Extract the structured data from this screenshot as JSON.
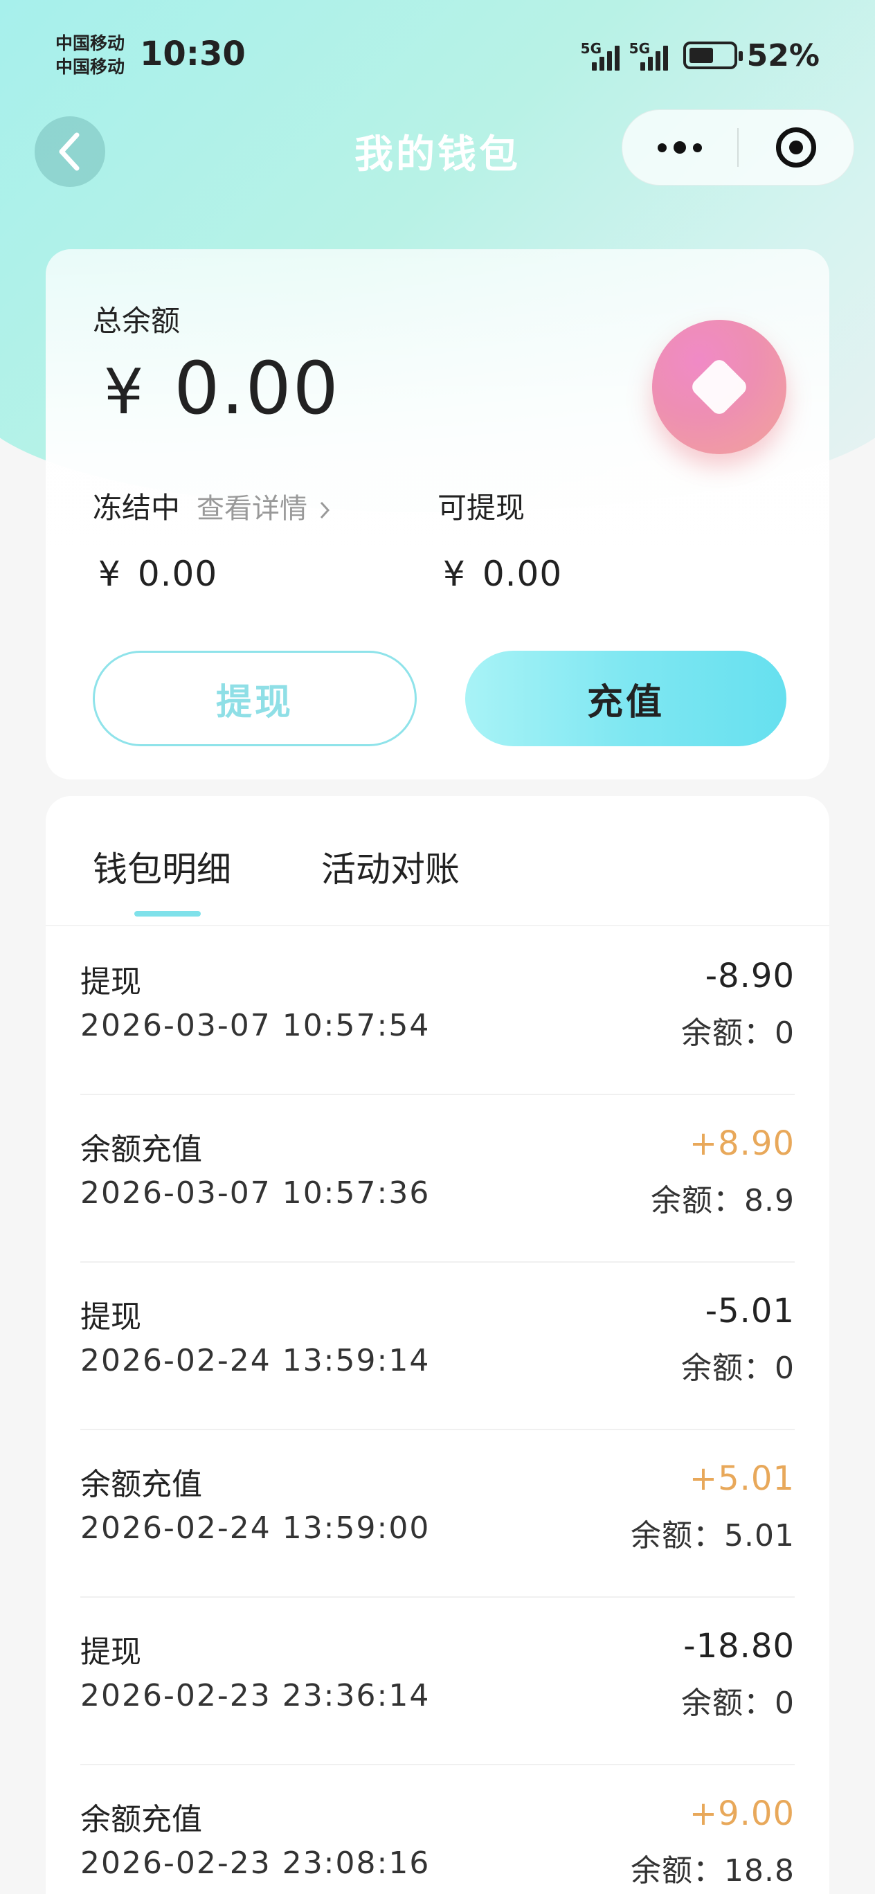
{
  "status_bar": {
    "carrier_1": "中国移动",
    "carrier_2": "中国移动",
    "time": "10:30",
    "signal_1": "5G",
    "signal_2": "5G",
    "battery": "52%"
  },
  "nav": {
    "title": "我的钱包",
    "back_icon": "chevron-left-icon",
    "more_icon": "more-dots-icon",
    "close_icon": "target-icon"
  },
  "balance": {
    "total_label": "总余额",
    "currency": "¥",
    "total_amount": "0.00",
    "frozen_label": "冻结中",
    "frozen_link": "查看详情",
    "frozen_amount": "0.00",
    "withdrawable_label": "可提现",
    "withdrawable_amount": "0.00",
    "withdraw_button": "提现",
    "recharge_button": "充值",
    "badge_icon": "diamond-icon"
  },
  "colors": {
    "accent": "#7fe1ea",
    "income": "#e8a85a",
    "badge": "#ee8fb2"
  },
  "tabs": [
    {
      "label": "钱包明细",
      "active": true
    },
    {
      "label": "活动对账",
      "active": false
    }
  ],
  "transactions": [
    {
      "type": "提现",
      "time": "2026-03-07 10:57:54",
      "amount": "-8.90",
      "balance": "余额：0",
      "positive": false
    },
    {
      "type": "余额充值",
      "time": "2026-03-07 10:57:36",
      "amount": "+8.90",
      "balance": "余额：8.9",
      "positive": true
    },
    {
      "type": "提现",
      "time": "2026-02-24 13:59:14",
      "amount": "-5.01",
      "balance": "余额：0",
      "positive": false
    },
    {
      "type": "余额充值",
      "time": "2026-02-24 13:59:00",
      "amount": "+5.01",
      "balance": "余额：5.01",
      "positive": true
    },
    {
      "type": "提现",
      "time": "2026-02-23 23:36:14",
      "amount": "-18.80",
      "balance": "余额：0",
      "positive": false
    },
    {
      "type": "余额充值",
      "time": "2026-02-23 23:08:16",
      "amount": "+9.00",
      "balance": "余额：18.8",
      "positive": true
    }
  ]
}
